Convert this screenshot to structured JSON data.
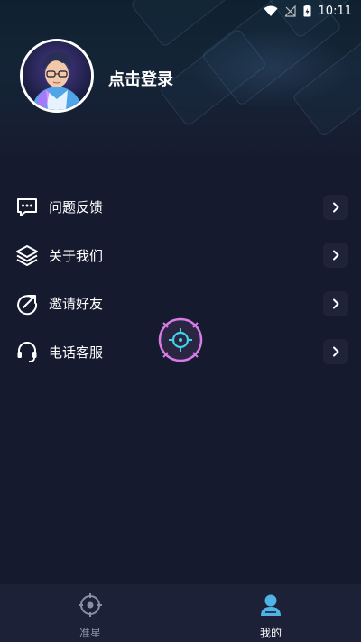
{
  "status_bar": {
    "time": "10:11"
  },
  "profile": {
    "login_label": "点击登录"
  },
  "menu": {
    "items": [
      {
        "label": "问题反馈",
        "icon": "feedback-icon"
      },
      {
        "label": "关于我们",
        "icon": "layers-icon"
      },
      {
        "label": "邀请好友",
        "icon": "share-arrow-icon"
      },
      {
        "label": "电话客服",
        "icon": "headset-icon"
      }
    ]
  },
  "tabbar": {
    "tabs": [
      {
        "label": "准星",
        "icon": "crosshair-icon",
        "active": false
      },
      {
        "label": "我的",
        "icon": "person-icon",
        "active": true
      }
    ]
  },
  "colors": {
    "background": "#161a2e",
    "tabbar_bg": "#1c2137",
    "active_tab_icon": "#4fb3e6",
    "inactive_tab": "#8a8fa6",
    "crosshair_ring": "#d77be6",
    "crosshair_center": "#3fd4e8"
  }
}
